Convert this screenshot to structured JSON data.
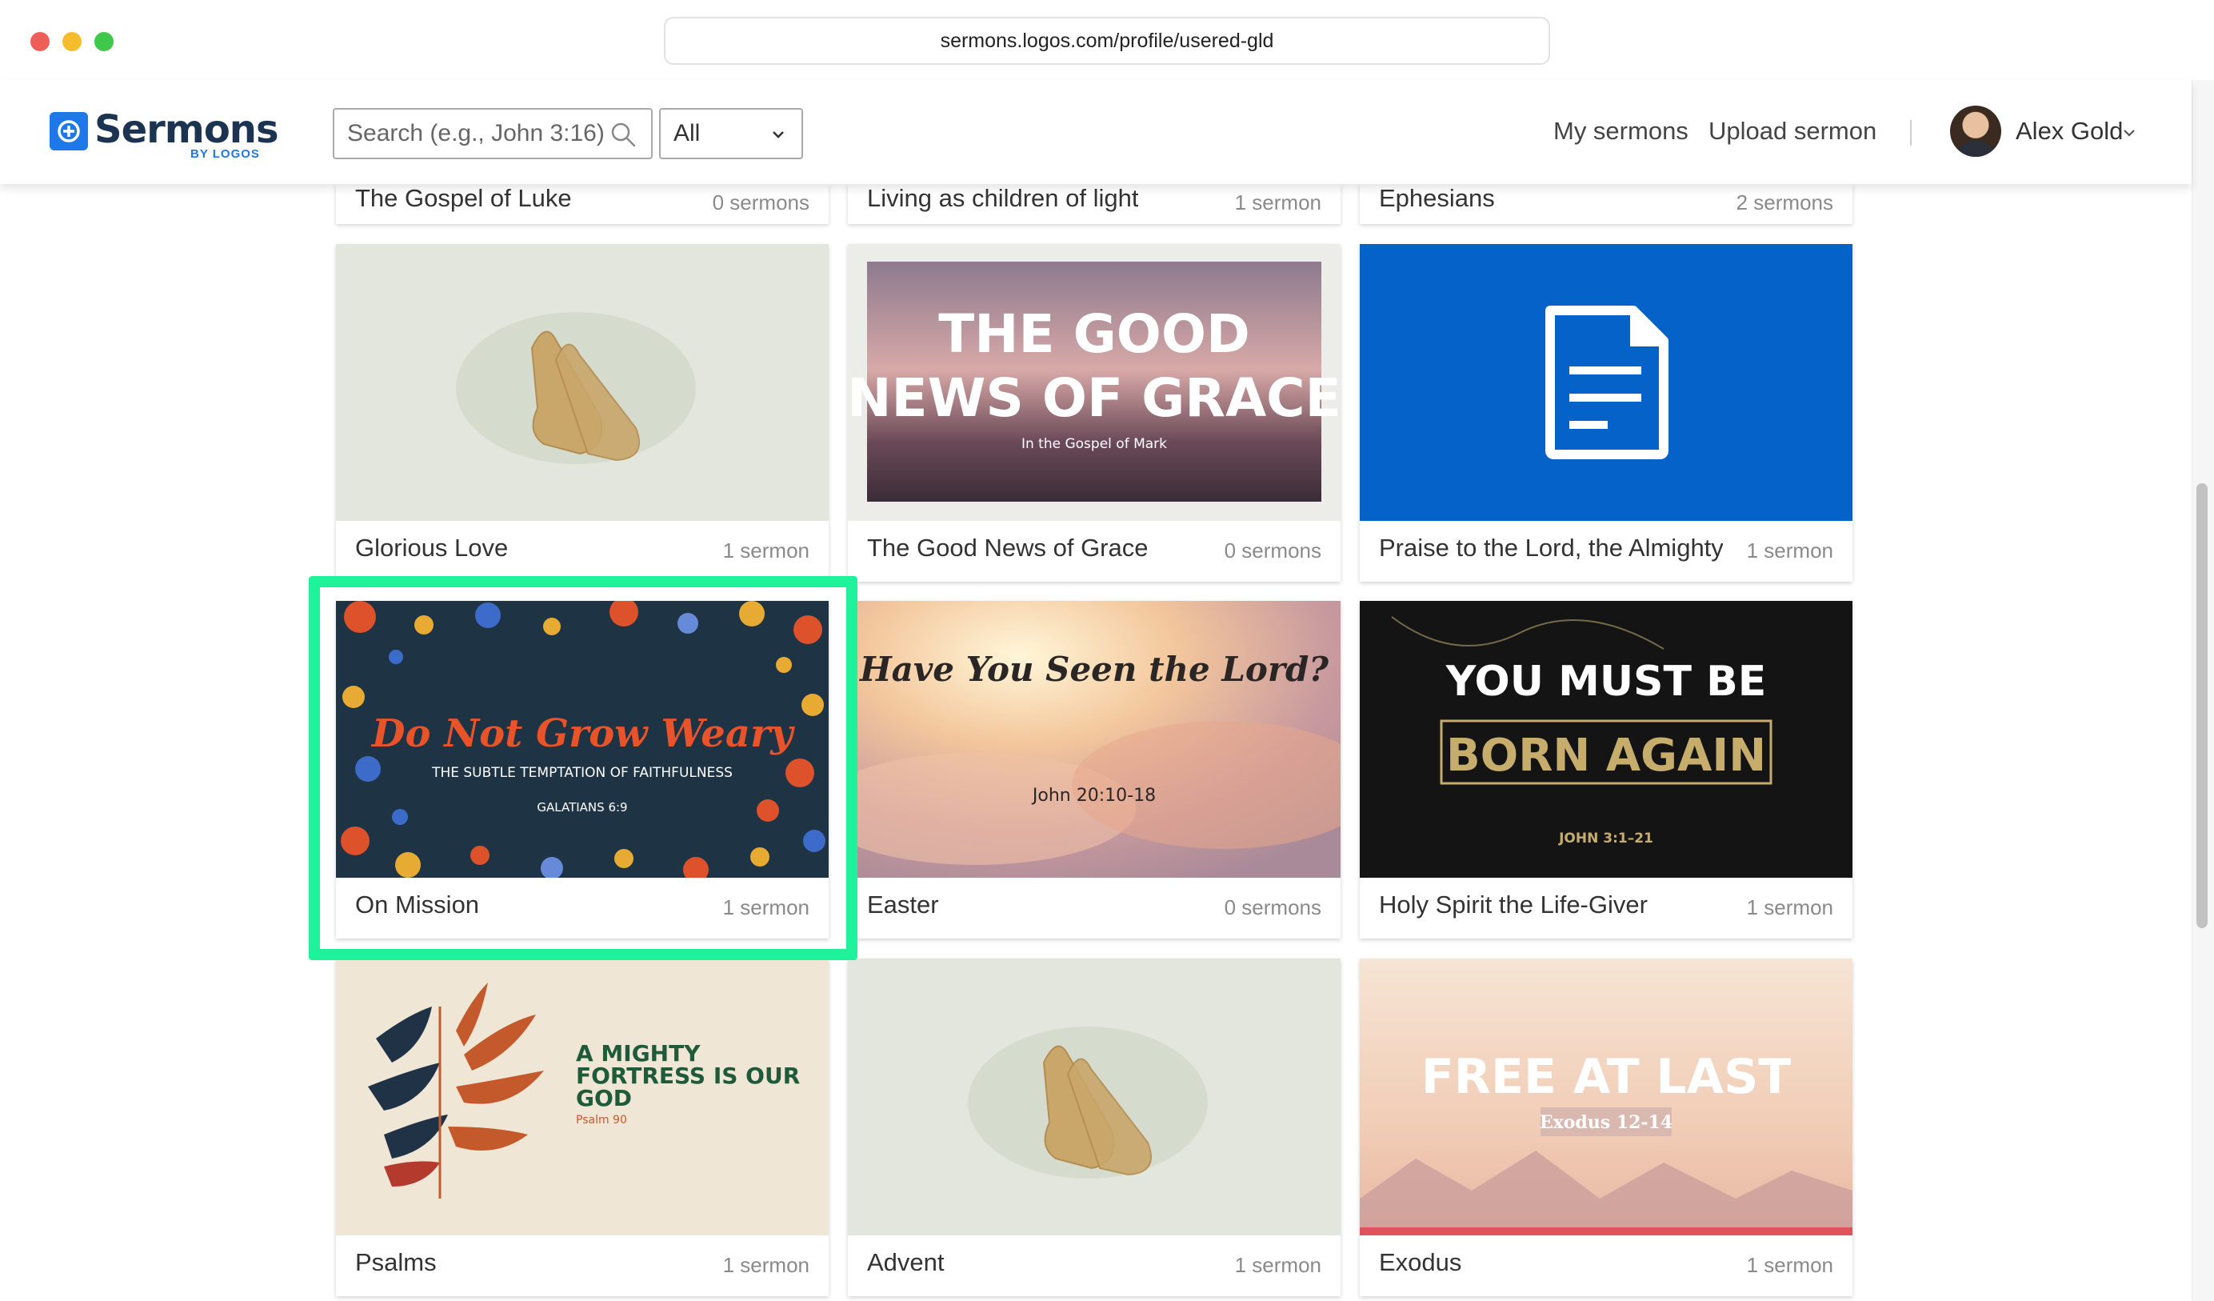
{
  "browser": {
    "url": "sermons.logos.com/profile/usered-gld"
  },
  "header": {
    "logo_text": "Sermons",
    "logo_sub": "BY LOGOS",
    "search_placeholder": "Search (e.g., John 3:16)",
    "scope_value": "All",
    "nav_my_sermons": "My sermons",
    "nav_upload": "Upload sermon",
    "user_name": "Alex Gold"
  },
  "top_row": [
    {
      "title": "The Gospel of Luke",
      "count": "0 sermons"
    },
    {
      "title": "Living as children of light",
      "count": "1 sermon"
    },
    {
      "title": "Ephesians",
      "count": "2 sermons"
    }
  ],
  "cards": [
    {
      "title": "Glorious Love",
      "count": "1 sermon"
    },
    {
      "title": "The Good News of Grace",
      "count": "0 sermons",
      "art": {
        "line1": "THE GOOD",
        "line2": "NEWS OF GRACE",
        "sub": "In the Gospel of Mark"
      }
    },
    {
      "title": "Praise to the Lord, the Almighty",
      "count": "1 sermon"
    },
    {
      "title": "On Mission",
      "count": "1 sermon",
      "art": {
        "line1": "Do Not Grow Weary",
        "line2": "THE SUBTLE TEMPTATION OF FAITHFULNESS",
        "sub": "GALATIANS 6:9"
      }
    },
    {
      "title": "Easter",
      "count": "0 sermons",
      "art": {
        "line1": "Have You Seen the Lord?",
        "sub": "John 20:10-18"
      }
    },
    {
      "title": "Holy Spirit the Life-Giver",
      "count": "1 sermon",
      "art": {
        "line1": "YOU MUST BE",
        "line2": "BORN AGAIN",
        "sub": "JOHN 3:1–21"
      }
    },
    {
      "title": "Psalms",
      "count": "1 sermon",
      "art": {
        "line1": "A MIGHTY",
        "line2": "FORTRESS IS OUR",
        "line3": "GOD",
        "sub": "Psalm 90"
      }
    },
    {
      "title": "Advent",
      "count": "1 sermon"
    },
    {
      "title": "Exodus",
      "count": "1 sermon",
      "art": {
        "line1": "FREE AT LAST",
        "sub": "Exodus 12-14"
      }
    }
  ],
  "colors": {
    "brand_blue": "#1f78e8",
    "highlight": "#1ef29a",
    "document_tile": "#0462c8"
  }
}
